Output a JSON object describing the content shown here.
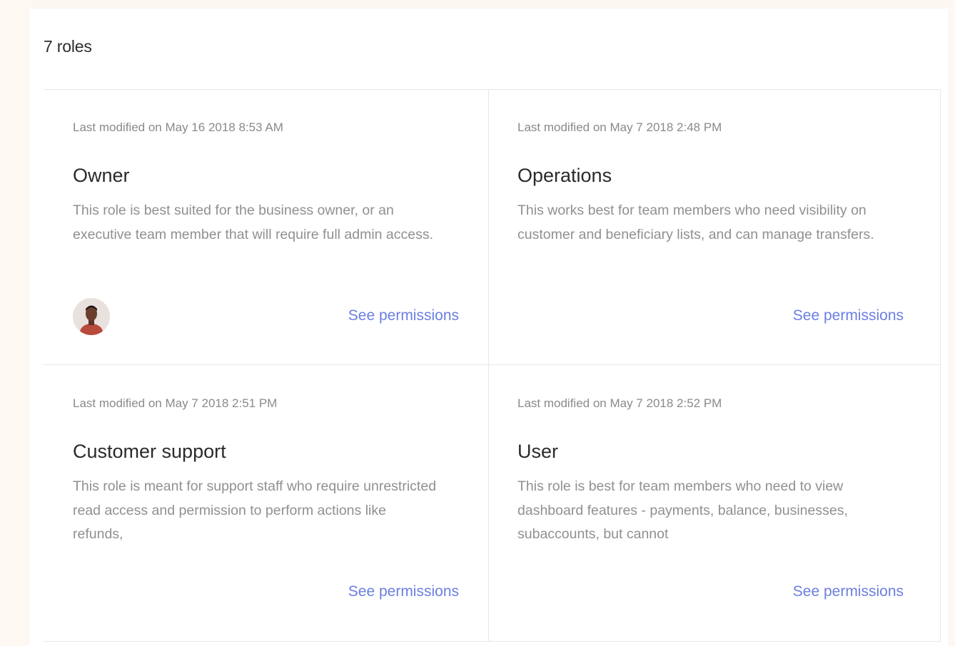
{
  "header": {
    "roles_count": "7 roles"
  },
  "roles": [
    {
      "modified": "Last modified on May 16 2018 8:53 AM",
      "title": "Owner",
      "desc": "This role is best suited for the business owner, or an executive team member that will require full admin access.",
      "link": "See permissions"
    },
    {
      "modified": "Last modified on May 7 2018 2:48 PM",
      "title": "Operations",
      "desc": "This works best for team members who need visibility on customer and beneficiary lists, and can manage transfers.",
      "link": "See permissions"
    },
    {
      "modified": "Last modified on May 7 2018 2:51 PM",
      "title": "Customer support",
      "desc": "This role is meant for support staff who require unrestricted read access and permission to perform actions like refunds,",
      "link": "See permissions"
    },
    {
      "modified": "Last modified on May 7 2018 2:52 PM",
      "title": "User",
      "desc": "This role is best for team members who need to view dashboard features - payments, balance, businesses, subaccounts, but cannot",
      "link": "See permissions"
    }
  ],
  "colors": {
    "background": "#fdf8f2",
    "link": "#6b7fe0",
    "divider": "#e7e7e7"
  }
}
